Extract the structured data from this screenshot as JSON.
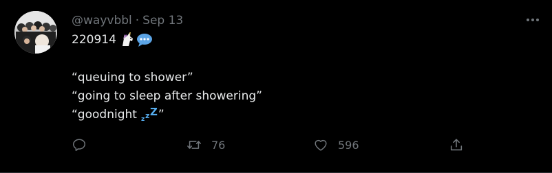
{
  "tweet": {
    "handle": "@wayvbbl",
    "separator": "·",
    "date": "Sep 13",
    "text_lines": [
      "220914",
      "“queuing to shower”",
      "“going to sleep after showering”",
      "“goodnight",
      "”"
    ],
    "emojis": {
      "line1": [
        "unicorn-emoji",
        "speech-bubble-emoji"
      ],
      "line4": [
        "zzz-emoji"
      ]
    }
  },
  "actions": {
    "reply_count": "",
    "retweet_count": "76",
    "like_count": "596"
  },
  "icons": {
    "more": "more-horizontal-icon",
    "reply": "reply-icon",
    "retweet": "retweet-icon",
    "like": "heart-icon",
    "share": "share-icon"
  },
  "colors": {
    "background": "#000000",
    "text_primary": "#e7e9ea",
    "text_secondary": "#71767b",
    "emoji_blue": "#55acee"
  }
}
